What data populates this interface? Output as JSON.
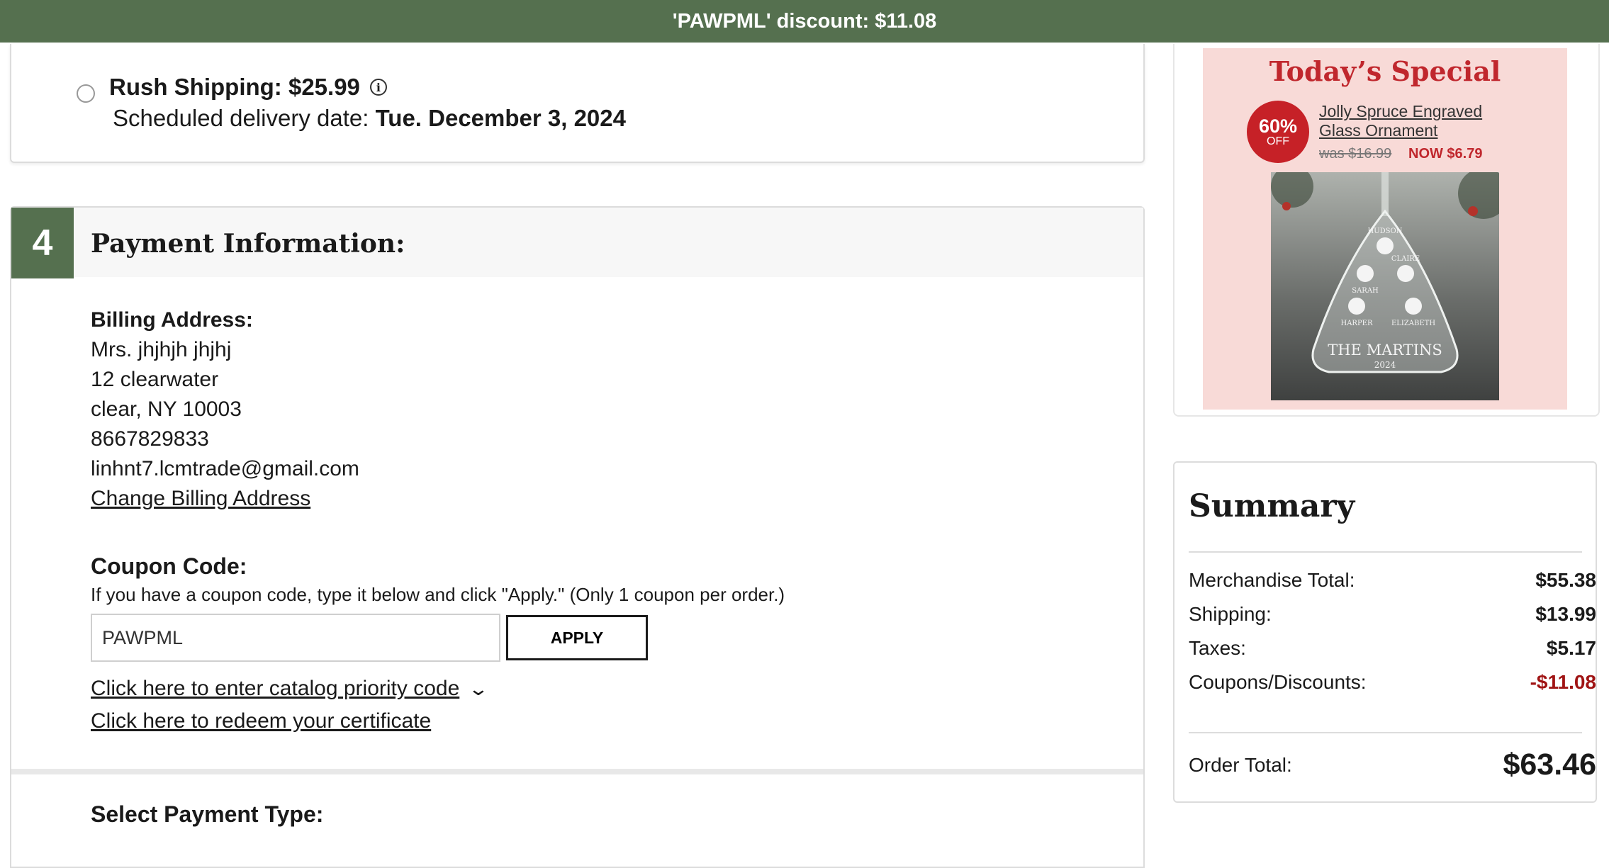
{
  "banner": {
    "text": "'PAWPML' discount: $11.08"
  },
  "shipping": {
    "option_label": "Rush Shipping: $25.99",
    "date_label": "Scheduled delivery date:",
    "date_value": "Tue. December 3, 2024",
    "info_icon": "info-icon"
  },
  "payment": {
    "step": "4",
    "title": "Payment Information:",
    "billing_label": "Billing Address:",
    "billing_lines": [
      "Mrs. jhjhjh jhjhj",
      "12 clearwater",
      "clear, NY 10003",
      "8667829833",
      "linhnt7.lcmtrade@gmail.com"
    ],
    "change_billing": "Change Billing Address",
    "coupon_label": "Coupon Code:",
    "coupon_help": "If you have a coupon code, type it below and click \"Apply.\" (Only 1 coupon per order.)",
    "coupon_value": "PAWPML",
    "apply_label": "APPLY",
    "catalog_link": "Click here to enter catalog priority code",
    "certificate_link": "Click here to redeem your certificate",
    "payment_type_label": "Select Payment Type:"
  },
  "promo": {
    "title": "Today’s Special",
    "badge_pct": "60%",
    "badge_off": "OFF",
    "product_line1": "Jolly Spruce Engraved",
    "product_line2": "Glass Ornament",
    "was_price": "was $16.99",
    "now_price": "NOW $6.79",
    "ornament_names": [
      "HUDSON",
      "CLAIRE",
      "SARAH",
      "HARPER",
      "ELIZABETH"
    ],
    "ornament_title": "THE MARTINS",
    "ornament_year": "2024"
  },
  "summary": {
    "title": "Summary",
    "rows": [
      {
        "label": "Merchandise Total:",
        "value": "$55.38"
      },
      {
        "label": "Shipping:",
        "value": "$13.99"
      },
      {
        "label": "Taxes:",
        "value": "$5.17"
      },
      {
        "label": "Coupons/Discounts:",
        "value": "-$11.08"
      }
    ],
    "total_label": "Order Total:",
    "total_value": "$63.46"
  },
  "colors": {
    "brand_green": "#55704f",
    "promo_red": "#c0272d",
    "discount_red": "#a01414",
    "promo_bg": "#f8dad7"
  }
}
